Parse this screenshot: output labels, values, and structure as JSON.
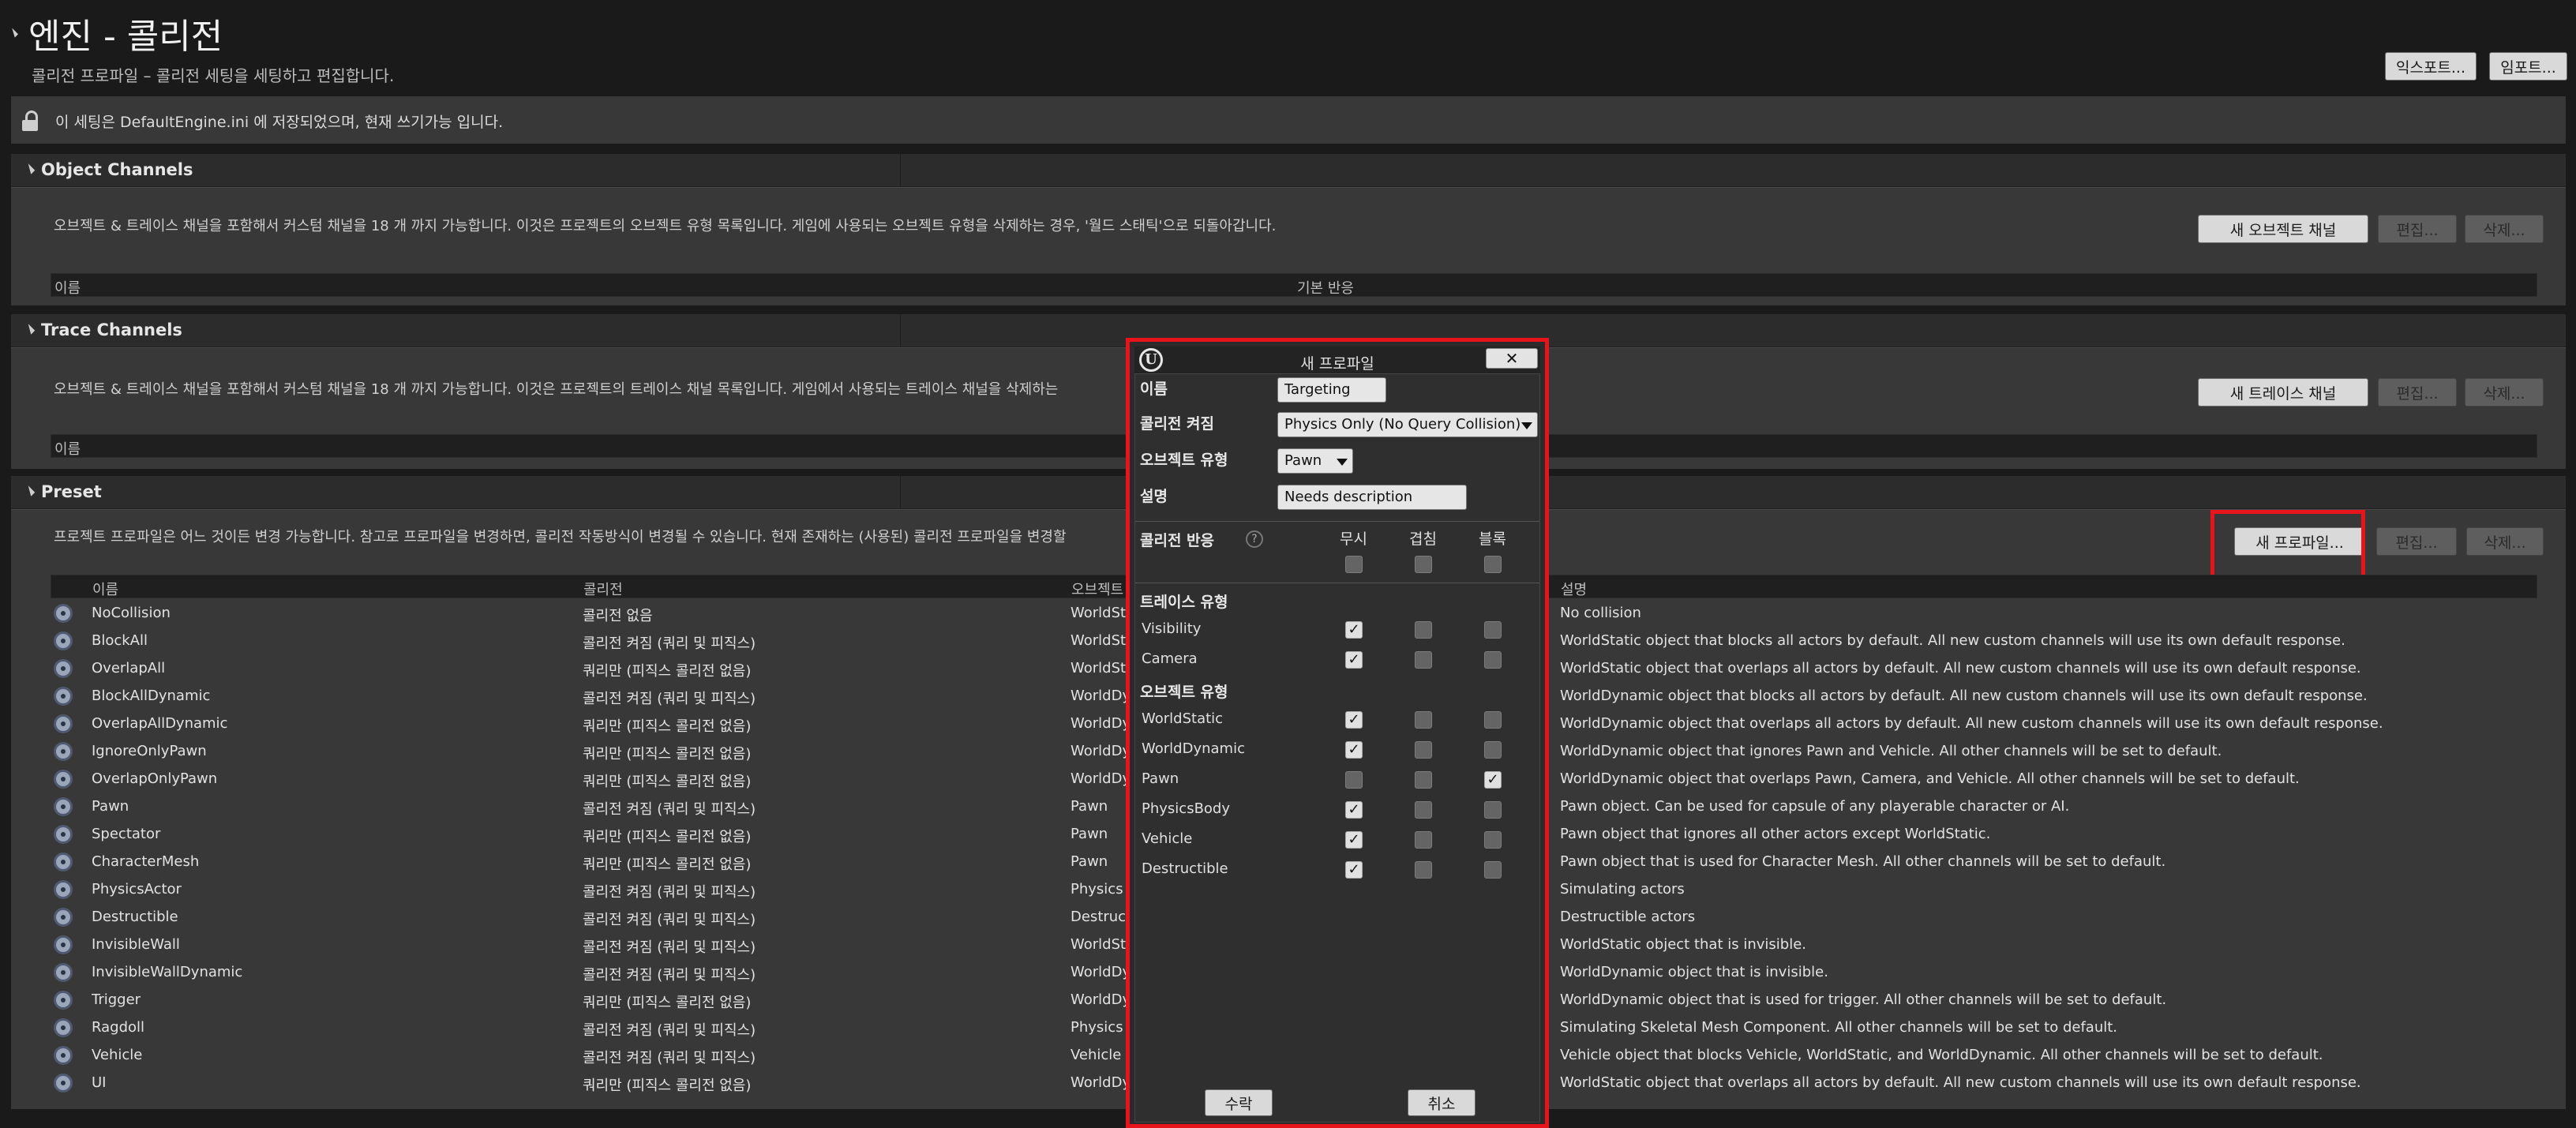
{
  "page": {
    "title": "엔진 - 콜리전",
    "subtitle": "콜리전 프로파일 – 콜리전 세팅을 세팅하고 편집합니다.",
    "export_label": "익스포트...",
    "import_label": "임포트...",
    "info_text": "이 세팅은 DefaultEngine.ini 에 저장되었으며, 현재 쓰기가능 입니다."
  },
  "object_channels": {
    "title": "Object Channels",
    "desc": "오브젝트 & 트레이스 채널을 포함해서 커스텀 채널을 18 개 까지 가능합니다. 이것은 프로젝트의 오브젝트 유형 목록입니다. 게임에 사용되는 오브젝트 유형을 삭제하는 경우, '월드 스태틱'으로 되돌아갑니다.",
    "new_label": "새 오브젝트 채널",
    "edit_label": "편집...",
    "delete_label": "삭제...",
    "col_name": "이름",
    "col_default": "기본 반응"
  },
  "trace_channels": {
    "title": "Trace Channels",
    "desc": "오브젝트 & 트레이스 채널을 포함해서 커스텀 채널을 18 개 까지 가능합니다. 이것은 프로젝트의 트레이스 채널 목록입니다. 게임에서 사용되는 트레이스 채널을 삭제하는",
    "new_label": "새 트레이스 채널",
    "edit_label": "편집...",
    "delete_label": "삭제...",
    "col_name": "이름"
  },
  "preset": {
    "title": "Preset",
    "desc": "프로젝트 프로파일은 어느 것이든 변경 가능합니다. 참고로 프로파일을 변경하면, 콜리전 작동방식이 변경될 수 있습니다. 현재 존재하는 (사용된) 콜리전 프로파일을 변경할",
    "new_label": "새 프로파일...",
    "edit_label": "편집...",
    "delete_label": "삭제...",
    "columns": [
      "이름",
      "콜리전",
      "오브젝트",
      "설명"
    ],
    "rows": [
      {
        "name": "NoCollision",
        "collision": "콜리전 없음",
        "object": "WorldSt",
        "desc": "No collision"
      },
      {
        "name": "BlockAll",
        "collision": "콜리전 켜짐 (쿼리 및 피직스)",
        "object": "WorldSt",
        "desc": "WorldStatic object that blocks all actors by default. All new custom channels will use its own default response."
      },
      {
        "name": "OverlapAll",
        "collision": "쿼리만 (피직스 콜리전 없음)",
        "object": "WorldSt",
        "desc": "WorldStatic object that overlaps all actors by default. All new custom channels will use its own default response."
      },
      {
        "name": "BlockAllDynamic",
        "collision": "콜리전 켜짐 (쿼리 및 피직스)",
        "object": "WorldDy",
        "desc": "WorldDynamic object that blocks all actors by default. All new custom channels will use its own default response."
      },
      {
        "name": "OverlapAllDynamic",
        "collision": "쿼리만 (피직스 콜리전 없음)",
        "object": "WorldDy",
        "desc": "WorldDynamic object that overlaps all actors by default. All new custom channels will use its own default response."
      },
      {
        "name": "IgnoreOnlyPawn",
        "collision": "쿼리만 (피직스 콜리전 없음)",
        "object": "WorldDy",
        "desc": "WorldDynamic object that ignores Pawn and Vehicle. All other channels will be set to default."
      },
      {
        "name": "OverlapOnlyPawn",
        "collision": "쿼리만 (피직스 콜리전 없음)",
        "object": "WorldDy",
        "desc": "WorldDynamic object that overlaps Pawn, Camera, and Vehicle. All other channels will be set to default."
      },
      {
        "name": "Pawn",
        "collision": "콜리전 켜짐 (쿼리 및 피직스)",
        "object": "Pawn",
        "desc": "Pawn object. Can be used for capsule of any playerable character or AI."
      },
      {
        "name": "Spectator",
        "collision": "쿼리만 (피직스 콜리전 없음)",
        "object": "Pawn",
        "desc": "Pawn object that ignores all other actors except WorldStatic."
      },
      {
        "name": "CharacterMesh",
        "collision": "쿼리만 (피직스 콜리전 없음)",
        "object": "Pawn",
        "desc": "Pawn object that is used for Character Mesh. All other channels will be set to default."
      },
      {
        "name": "PhysicsActor",
        "collision": "콜리전 켜짐 (쿼리 및 피직스)",
        "object": "Physics",
        "desc": "Simulating actors"
      },
      {
        "name": "Destructible",
        "collision": "콜리전 켜짐 (쿼리 및 피직스)",
        "object": "Destruc",
        "desc": "Destructible actors"
      },
      {
        "name": "InvisibleWall",
        "collision": "콜리전 켜짐 (쿼리 및 피직스)",
        "object": "WorldSt",
        "desc": "WorldStatic object that is invisible."
      },
      {
        "name": "InvisibleWallDynamic",
        "collision": "콜리전 켜짐 (쿼리 및 피직스)",
        "object": "WorldDy",
        "desc": "WorldDynamic object that is invisible."
      },
      {
        "name": "Trigger",
        "collision": "쿼리만 (피직스 콜리전 없음)",
        "object": "WorldDy",
        "desc": "WorldDynamic object that is used for trigger. All other channels will be set to default."
      },
      {
        "name": "Ragdoll",
        "collision": "콜리전 켜짐 (쿼리 및 피직스)",
        "object": "Physics",
        "desc": "Simulating Skeletal Mesh Component. All other channels will be set to default."
      },
      {
        "name": "Vehicle",
        "collision": "콜리전 켜짐 (쿼리 및 피직스)",
        "object": "Vehicle",
        "desc": "Vehicle object that blocks Vehicle, WorldStatic, and WorldDynamic. All other channels will be set to default."
      },
      {
        "name": "UI",
        "collision": "쿼리만 (피직스 콜리전 없음)",
        "object": "WorldDy",
        "desc": "WorldStatic object that overlaps all actors by default. All new custom channels will use its own default response."
      }
    ]
  },
  "dialog": {
    "title": "새 프로파일",
    "close_glyph": "✕",
    "name_label": "이름",
    "name_value": "Targeting",
    "collision_label": "콜리전 켜짐",
    "collision_value": "Physics Only (No Query Collision)",
    "object_type_label": "오브젝트 유형",
    "object_type_value": "Pawn",
    "desc_label": "설명",
    "desc_value": "Needs description",
    "response_label": "콜리전 반응",
    "help_glyph": "?",
    "col_ignore": "무시",
    "col_overlap": "겹침",
    "col_block": "블록",
    "trace_header": "트레이스 유형",
    "object_header": "오브젝트 유형",
    "check_glyph": "✓",
    "trace_rows": [
      {
        "name": "Visibility",
        "ignore": true,
        "overlap": false,
        "block": false
      },
      {
        "name": "Camera",
        "ignore": true,
        "overlap": false,
        "block": false
      }
    ],
    "object_rows": [
      {
        "name": "WorldStatic",
        "ignore": true,
        "overlap": false,
        "block": false
      },
      {
        "name": "WorldDynamic",
        "ignore": true,
        "overlap": false,
        "block": false
      },
      {
        "name": "Pawn",
        "ignore": false,
        "overlap": false,
        "block": true
      },
      {
        "name": "PhysicsBody",
        "ignore": true,
        "overlap": false,
        "block": false
      },
      {
        "name": "Vehicle",
        "ignore": true,
        "overlap": false,
        "block": false
      },
      {
        "name": "Destructible",
        "ignore": true,
        "overlap": false,
        "block": false
      }
    ],
    "accept_label": "수락",
    "cancel_label": "취소"
  },
  "colors": {
    "highlight": "#e8141b",
    "background": "#1a1a1a",
    "panel": "#383838"
  }
}
